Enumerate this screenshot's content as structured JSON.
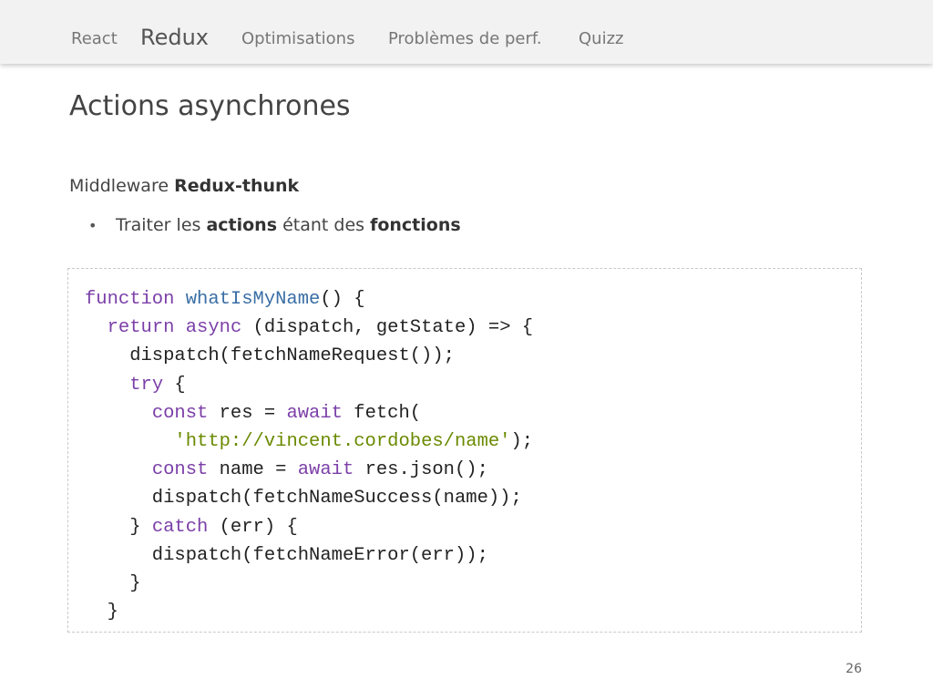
{
  "nav": {
    "items": [
      {
        "label": "React"
      },
      {
        "label": "Redux"
      },
      {
        "label": "Optimisations"
      },
      {
        "label": "Problèmes de perf."
      },
      {
        "label": "Quizz"
      }
    ],
    "active_index": 1
  },
  "slide": {
    "title": "Actions asynchrones",
    "intro": {
      "prefix": "Middleware ",
      "bold": "Redux-thunk"
    },
    "bullet": {
      "bullet_glyph": "•",
      "part1": "Traiter les ",
      "bold1": "actions",
      "part2": " étant des ",
      "bold2": "fonctions"
    },
    "page_number": "26"
  },
  "code": {
    "lines": [
      [
        {
          "t": "function ",
          "c": "kw"
        },
        {
          "t": "whatIsMyName",
          "c": "fn"
        },
        {
          "t": "() {",
          "c": ""
        }
      ],
      [
        {
          "t": "  ",
          "c": ""
        },
        {
          "t": "return ",
          "c": "kw"
        },
        {
          "t": "async ",
          "c": "kw"
        },
        {
          "t": "(dispatch, getState) => {",
          "c": ""
        }
      ],
      [
        {
          "t": "    dispatch(fetchNameRequest());",
          "c": ""
        }
      ],
      [
        {
          "t": "    ",
          "c": ""
        },
        {
          "t": "try",
          "c": "kw"
        },
        {
          "t": " {",
          "c": ""
        }
      ],
      [
        {
          "t": "      ",
          "c": ""
        },
        {
          "t": "const",
          "c": "kw"
        },
        {
          "t": " res = ",
          "c": ""
        },
        {
          "t": "await",
          "c": "kw"
        },
        {
          "t": " fetch(",
          "c": ""
        }
      ],
      [
        {
          "t": "        ",
          "c": ""
        },
        {
          "t": "'http://vincent.cordobes/name'",
          "c": "str"
        },
        {
          "t": ");",
          "c": ""
        }
      ],
      [
        {
          "t": "      ",
          "c": ""
        },
        {
          "t": "const",
          "c": "kw"
        },
        {
          "t": " name = ",
          "c": ""
        },
        {
          "t": "await",
          "c": "kw"
        },
        {
          "t": " res.json();",
          "c": ""
        }
      ],
      [
        {
          "t": "      dispatch(fetchNameSuccess(name));",
          "c": ""
        }
      ],
      [
        {
          "t": "    } ",
          "c": ""
        },
        {
          "t": "catch",
          "c": "kw"
        },
        {
          "t": " (err) {",
          "c": ""
        }
      ],
      [
        {
          "t": "      dispatch(fetchNameError(err));",
          "c": ""
        }
      ],
      [
        {
          "t": "    }",
          "c": ""
        }
      ],
      [
        {
          "t": "  }",
          "c": ""
        }
      ]
    ]
  }
}
